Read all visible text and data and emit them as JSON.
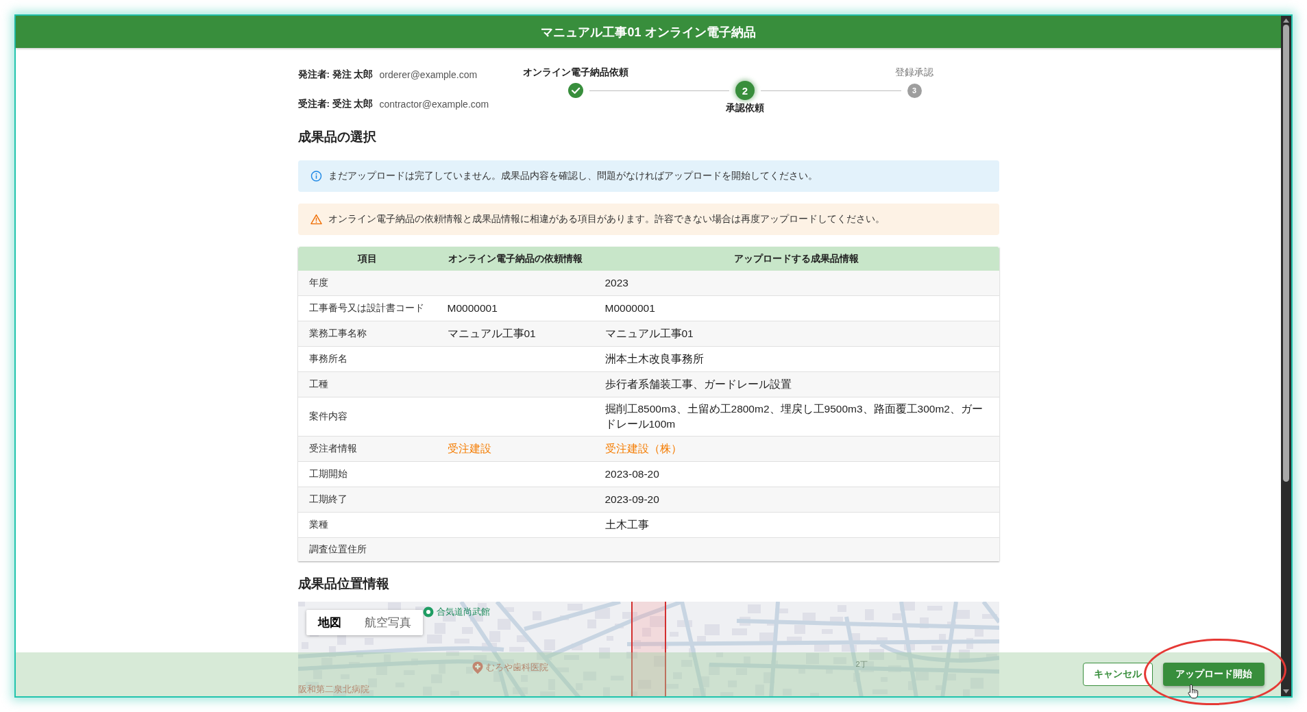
{
  "dialog": {
    "title": "マニュアル工事01 オンライン電子納品"
  },
  "parties": [
    {
      "label": "発注者: 発注 太郎",
      "email": "orderer@example.com"
    },
    {
      "label": "受注者: 受注 太郎",
      "email": "contractor@example.com"
    }
  ],
  "stepper": {
    "steps": [
      {
        "label": "オンライン電子納品依頼",
        "completed": true,
        "active": false
      },
      {
        "label": "承認依頼",
        "number": "2",
        "completed": false,
        "active": true
      },
      {
        "label": "登録承認",
        "number": "3",
        "completed": false,
        "active": false
      }
    ]
  },
  "selection": {
    "heading": "成果品の選択",
    "alerts": [
      {
        "kind": "info",
        "text": "まだアップロードは完了していません。成果品内容を確認し、問題がなければアップロードを開始してください。"
      },
      {
        "kind": "warning",
        "text": "オンライン電子納品の依頼情報と成果品情報に相違がある項目があります。許容できない場合は再度アップロードしてください。"
      }
    ],
    "table": {
      "columns": [
        "項目",
        "オンライン電子納品の依頼情報",
        "アップロードする成果品情報"
      ],
      "rows": [
        {
          "item": "年度",
          "uploaded": {
            "text": "2023",
            "mismatch": false
          }
        },
        {
          "item": "工事番号又は設計書コード",
          "requested": {
            "text": "M0000001",
            "mismatch": false
          },
          "uploaded": {
            "text": "M0000001",
            "mismatch": false
          }
        },
        {
          "item": "業務工事名称",
          "requested": {
            "text": "マニュアル工事01",
            "mismatch": false
          },
          "uploaded": {
            "text": "マニュアル工事01",
            "mismatch": false
          }
        },
        {
          "item": "事務所名",
          "uploaded": {
            "text": "洲本土木改良事務所",
            "mismatch": false
          }
        },
        {
          "item": "工種",
          "uploaded": {
            "text": "歩行者系舗装工事、ガードレール設置",
            "mismatch": false
          }
        },
        {
          "item": "案件内容",
          "uploaded": {
            "text": "掘削工8500m3、土留め工2800m2、埋戻し工9500m3、路面覆工300m2、ガードレール100m",
            "mismatch": false
          }
        },
        {
          "item": "受注者情報",
          "requested": {
            "text": "受注建設",
            "mismatch": true
          },
          "uploaded": {
            "text": "受注建設（株）",
            "mismatch": true
          }
        },
        {
          "item": "工期開始",
          "uploaded": {
            "text": "2023-08-20",
            "mismatch": false
          }
        },
        {
          "item": "工期終了",
          "uploaded": {
            "text": "2023-09-20",
            "mismatch": false
          }
        },
        {
          "item": "業種",
          "uploaded": {
            "text": "土木工事",
            "mismatch": false
          }
        },
        {
          "item": "調査位置住所"
        }
      ]
    }
  },
  "location": {
    "heading": "成果品位置情報",
    "map": {
      "view_tabs": [
        {
          "label": "地図",
          "selected": true
        },
        {
          "label": "航空写真",
          "selected": false
        }
      ],
      "labels": [
        {
          "text": "合気道尚武館",
          "kind": "park",
          "marker": true
        },
        {
          "text": "むろや歯科医院",
          "kind": "medical",
          "marker": true
        },
        {
          "text": "阪和第二泉北病院",
          "kind": "medical",
          "marker": false
        },
        {
          "text": "2丁",
          "kind": "district",
          "marker": false
        }
      ]
    }
  },
  "actions": [
    {
      "label": "キャンセル",
      "kind": "secondary"
    },
    {
      "label": "アップロード開始",
      "kind": "primary"
    }
  ]
}
